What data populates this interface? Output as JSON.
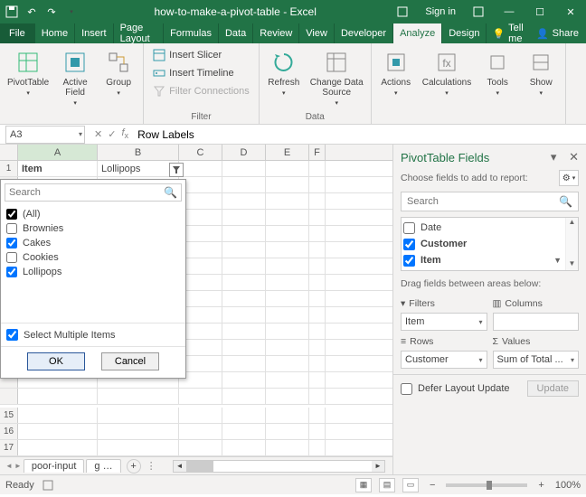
{
  "titlebar": {
    "title": "how-to-make-a-pivot-table - Excel",
    "signin": "Sign in"
  },
  "tabs": {
    "file": "File",
    "items": [
      "Home",
      "Insert",
      "Page Layout",
      "Formulas",
      "Data",
      "Review",
      "View",
      "Developer",
      "Analyze",
      "Design"
    ],
    "active": "Analyze",
    "tellme": "Tell me",
    "share": "Share"
  },
  "ribbon": {
    "pivottable": "PivotTable",
    "active_field": "Active\nField",
    "group": "Group",
    "insert_slicer": "Insert Slicer",
    "insert_timeline": "Insert Timeline",
    "filter_connections": "Filter Connections",
    "filter_group": "Filter",
    "refresh": "Refresh",
    "change_data": "Change Data\nSource",
    "data_group": "Data",
    "actions": "Actions",
    "calculations": "Calculations",
    "tools": "Tools",
    "show": "Show"
  },
  "namebox": "A3",
  "formula": "Row Labels",
  "columns": [
    "A",
    "B",
    "C",
    "D",
    "E",
    "F"
  ],
  "row1": {
    "label": "1",
    "a": "Item",
    "b": "Lollipops"
  },
  "filter_popup": {
    "search_ph": "Search",
    "items": [
      {
        "label": "(All)",
        "checked": true,
        "indeterminate": true
      },
      {
        "label": "Brownies",
        "checked": false
      },
      {
        "label": "Cakes",
        "checked": true
      },
      {
        "label": "Cookies",
        "checked": false
      },
      {
        "label": "Lollipops",
        "checked": true
      }
    ],
    "smi": "Select Multiple Items",
    "ok": "OK",
    "cancel": "Cancel"
  },
  "bottom_rows": [
    "15",
    "16",
    "17"
  ],
  "sheets": [
    "poor-input",
    "g …"
  ],
  "pane": {
    "title": "PivotTable Fields",
    "subtitle": "Choose fields to add to report:",
    "search_ph": "Search",
    "fields": [
      {
        "label": "Date",
        "checked": false
      },
      {
        "label": "Customer",
        "checked": true
      },
      {
        "label": "Item",
        "checked": true,
        "filterable": true
      }
    ],
    "drag_title": "Drag fields between areas below:",
    "filters_label": "Filters",
    "columns_label": "Columns",
    "rows_label": "Rows",
    "values_label": "Values",
    "filters_drop": "Item",
    "rows_drop": "Customer",
    "values_drop": "Sum of Total ...",
    "defer": "Defer Layout Update",
    "update": "Update"
  },
  "status": {
    "ready": "Ready",
    "zoom": "100%"
  }
}
